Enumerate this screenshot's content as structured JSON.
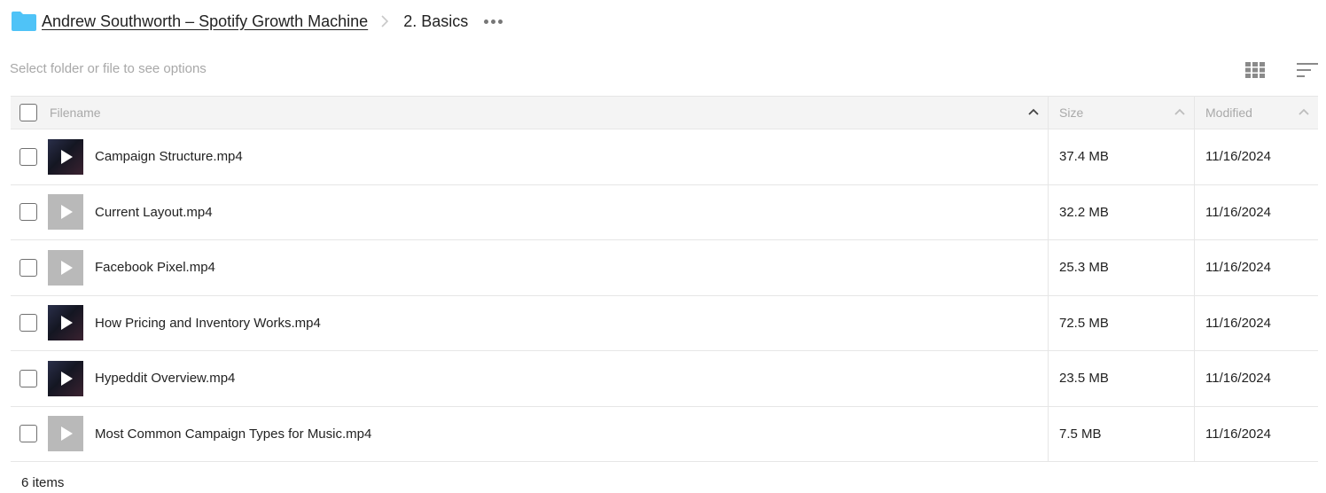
{
  "breadcrumb": {
    "folder_icon": "folder-icon",
    "folder_color": "#4fc3f7",
    "parent": "Andrew Southworth – Spotify Growth Machine",
    "current": "2. Basics",
    "more_icon": "more-horizontal-icon"
  },
  "toolbar": {
    "hint": "Select folder or file to see options",
    "grid_icon": "grid-view-icon",
    "sort_icon": "sort-icon"
  },
  "table": {
    "headers": {
      "filename": "Filename",
      "size": "Size",
      "modified": "Modified"
    },
    "rows": [
      {
        "name": "Campaign Structure.mp4",
        "size": "37.4 MB",
        "modified": "11/16/2024",
        "thumb": "dark"
      },
      {
        "name": "Current Layout.mp4",
        "size": "32.2 MB",
        "modified": "11/16/2024",
        "thumb": "gray"
      },
      {
        "name": "Facebook Pixel.mp4",
        "size": "25.3 MB",
        "modified": "11/16/2024",
        "thumb": "gray"
      },
      {
        "name": "How Pricing and Inventory Works.mp4",
        "size": "72.5 MB",
        "modified": "11/16/2024",
        "thumb": "dark"
      },
      {
        "name": "Hypeddit Overview.mp4",
        "size": "23.5 MB",
        "modified": "11/16/2024",
        "thumb": "dark"
      },
      {
        "name": "Most Common Campaign Types for Music.mp4",
        "size": "7.5 MB",
        "modified": "11/16/2024",
        "thumb": "gray"
      }
    ]
  },
  "footer": {
    "count": "6 items"
  }
}
